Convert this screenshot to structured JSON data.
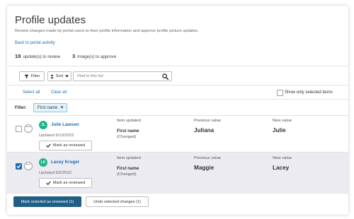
{
  "header": {
    "title": "Profile updates",
    "description": "Review changes made by portal users to their profile information and approve profile picture updates.",
    "back_link": "Back to portal activity"
  },
  "summary": {
    "updates_count": "18",
    "updates_label": "update(s) to review",
    "images_count": "3",
    "images_label": "image(s) to approve"
  },
  "toolbar": {
    "filter_label": "Filter",
    "sort_label": "Sort",
    "search_placeholder": "Find in this list"
  },
  "selection": {
    "select_all": "Select all",
    "clear_all": "Clear all",
    "show_only_selected": "Show only selected items"
  },
  "active_filter": {
    "label": "Filter:",
    "chip": "First name",
    "chip_remove": "×"
  },
  "columns": {
    "item_updated": "Item updated",
    "previous_value": "Previous value",
    "new_value": "New value"
  },
  "rows": [
    {
      "initials": "JL",
      "name": "Julie Lawson",
      "updated": "Updated 9/13/2022",
      "mark_label": "Mark as reviewed",
      "field": "First name",
      "change": "(Changed)",
      "previous": "Juliana",
      "new": "Julie",
      "selected": false
    },
    {
      "initials": "LK",
      "name": "Lacey Kruger",
      "updated": "Updated 9/2/2022",
      "mark_label": "Mark as reviewed",
      "field": "First name",
      "change": "(Changed)",
      "previous": "Maggie",
      "new": "Lacey",
      "selected": true
    }
  ],
  "footer": {
    "mark_selected": "Mark selected as reviewed (1)",
    "undo_selected": "Undo selected changes (1)"
  },
  "more_glyph": "···",
  "colors": {
    "link": "#1f6fb0",
    "primary_button": "#1f5e86",
    "avatar": "#20b38a",
    "selected_row": "#ecebf2",
    "chip_bg": "#e4f2f9"
  },
  "icons": [
    "filter-icon",
    "sort-icon",
    "chevron-down-icon",
    "search-icon",
    "close-icon",
    "check-icon",
    "more-icon"
  ]
}
